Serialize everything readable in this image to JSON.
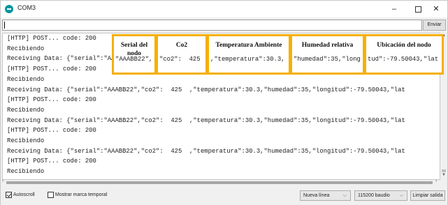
{
  "window": {
    "title": "COM3",
    "minimize_glyph": "–",
    "close_glyph": "✕"
  },
  "sendbar": {
    "input_value": "",
    "send_label": "Enviar"
  },
  "output": {
    "lines": [
      "[HTTP] POST... code: 200",
      "Recibiendo",
      "Receiving Data: {\"serial\":\"AAABB22\",\"co2\":  425  ,\"temperatura\":30.3,\"humedad\":35,\"longitud\":-79.50043,\"lat",
      "[HTTP] POST... code: 200",
      "Recibiendo",
      "Receiving Data: {\"serial\":\"AAABB22\",\"co2\":  425  ,\"temperatura\":30.3,\"humedad\":35,\"longitud\":-79.50043,\"lat",
      "[HTTP] POST... code: 200",
      "Recibiendo",
      "Receiving Data: {\"serial\":\"AAABB22\",\"co2\":  425  ,\"temperatura\":30.3,\"humedad\":35,\"longitud\":-79.50043,\"lat",
      "[HTTP] POST... code: 200",
      "Recibiendo",
      "Receiving Data: {\"serial\":\"AAABB22\",\"co2\":  425  ,\"temperatura\":30.3,\"humedad\":35,\"longitud\":-79.50043,\"lat",
      "[HTTP] POST... code: 200",
      "Recibiendo"
    ]
  },
  "annotations": [
    {
      "label": "Serial del nodo",
      "value": "\"AAABB22\","
    },
    {
      "label": "Co2",
      "value": "\"co2\":  425"
    },
    {
      "label": "Temperatura Ambiente",
      "value": ",\"temperatura\":30.3,"
    },
    {
      "label": "Humedad relativa",
      "value": "\"humedad\":35,\"long"
    },
    {
      "label": "Ubicación del nodo",
      "value": "tud\":-79.50043,\"lat"
    }
  ],
  "bottombar": {
    "autoscroll_label": "Autoscroll",
    "autoscroll_checked": true,
    "timestamp_label": "Mostrar marca temporal",
    "timestamp_checked": false,
    "line_ending": "Nueva línea",
    "baud_rate": "115200 baudio",
    "clear_label": "Limpiar salida"
  },
  "icons": {
    "app": "arduino-icon",
    "dropdown": "chevron-down-icon"
  },
  "colors": {
    "annotation_border": "#f6b000",
    "app_icon": "#00979c"
  }
}
